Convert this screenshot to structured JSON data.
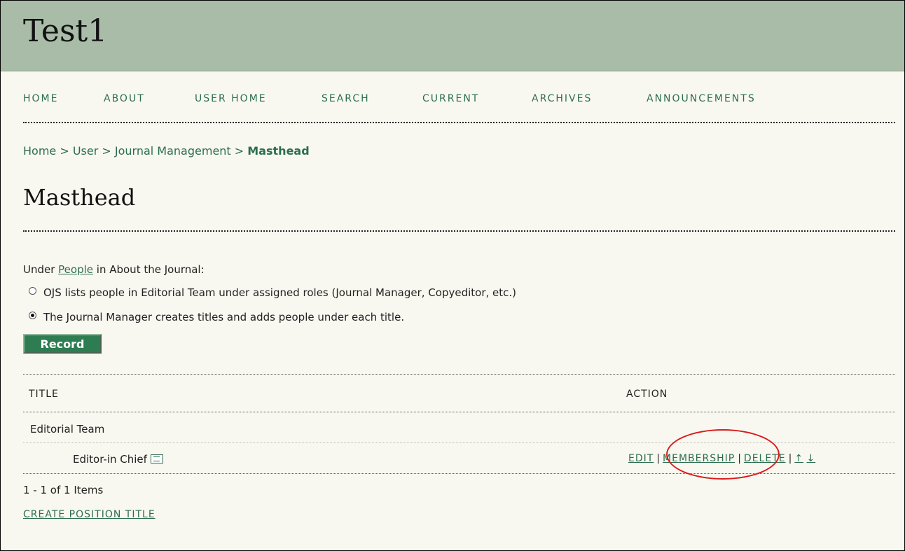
{
  "site": {
    "title": "Test1"
  },
  "nav": [
    {
      "label": "HOME"
    },
    {
      "label": "ABOUT"
    },
    {
      "label": "USER HOME"
    },
    {
      "label": "SEARCH"
    },
    {
      "label": "CURRENT"
    },
    {
      "label": "ARCHIVES"
    },
    {
      "label": "ANNOUNCEMENTS"
    }
  ],
  "breadcrumb": {
    "home": "Home",
    "sep": " > ",
    "user": "User",
    "management": "Journal Management",
    "current": "Masthead"
  },
  "page": {
    "title": "Masthead"
  },
  "form": {
    "intro_prefix": "Under ",
    "intro_link": "People",
    "intro_suffix": " in About the Journal:",
    "option1": "OJS lists people in Editorial Team under assigned roles (Journal Manager, Copyeditor, etc.)",
    "option2": "The Journal Manager creates titles and adds people under each title.",
    "selected_option": 2,
    "record_label": "Record"
  },
  "table": {
    "col_title": "TITLE",
    "col_action": "ACTION",
    "group": "Editorial Team",
    "row": {
      "title": "Editor-in Chief",
      "icon": "biography-icon",
      "edit": "EDIT",
      "membership": "MEMBERSHIP",
      "delete": "DELETE",
      "up": "↑",
      "down": "↓"
    },
    "sep": "|",
    "items_text": "1 - 1 of 1 Items",
    "create_label": "CREATE POSITION TITLE"
  },
  "colors": {
    "header": "#a8bca8",
    "link": "#2b6e4f",
    "button": "#2e7d52",
    "highlight": "#d81c1c"
  }
}
